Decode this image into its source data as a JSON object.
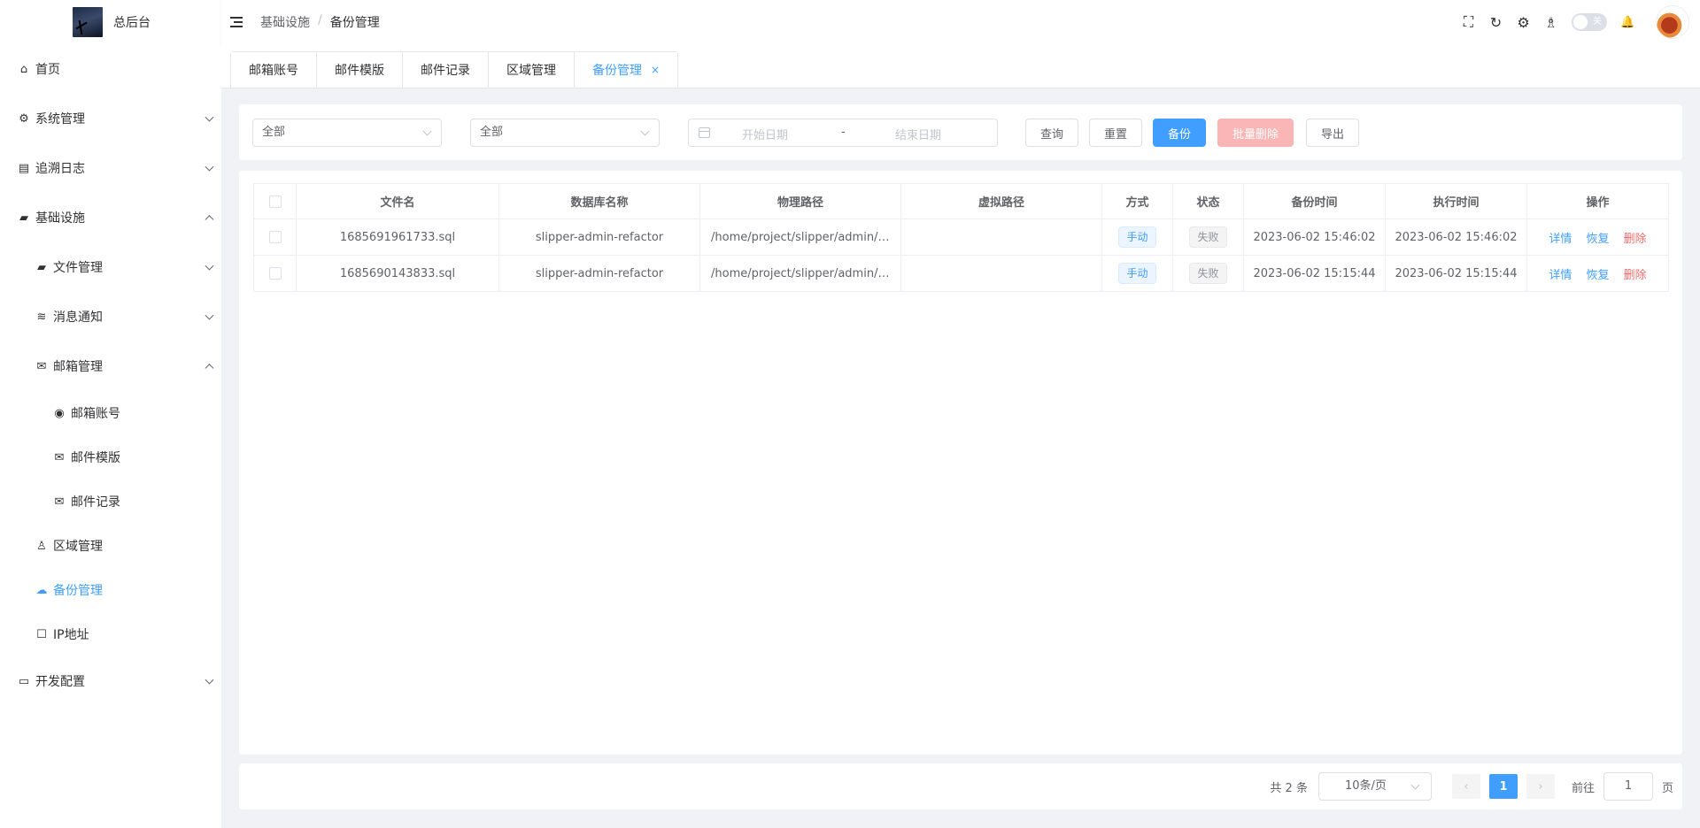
{
  "app": {
    "title": "总后台"
  },
  "sidebar": {
    "items": [
      {
        "label": "首页",
        "icon": "home-icon",
        "glyph": "⌂"
      },
      {
        "label": "系统管理",
        "icon": "gear-icon",
        "glyph": "⚙"
      },
      {
        "label": "追溯日志",
        "icon": "log-icon",
        "glyph": "▤"
      },
      {
        "label": "基础设施",
        "icon": "folder-icon",
        "glyph": "▰"
      },
      {
        "label": "文件管理",
        "icon": "folder-icon",
        "glyph": "▰"
      },
      {
        "label": "消息通知",
        "icon": "database-icon",
        "glyph": "≋"
      },
      {
        "label": "邮箱管理",
        "icon": "mail-icon",
        "glyph": "✉"
      },
      {
        "label": "邮箱账号",
        "icon": "account-icon",
        "glyph": "◉"
      },
      {
        "label": "邮件模版",
        "icon": "mail-icon",
        "glyph": "✉"
      },
      {
        "label": "邮件记录",
        "icon": "mail-icon",
        "glyph": "✉"
      },
      {
        "label": "区域管理",
        "icon": "user-icon",
        "glyph": "♙"
      },
      {
        "label": "备份管理",
        "icon": "cloud-upload-icon",
        "glyph": "☁"
      },
      {
        "label": "IP地址",
        "icon": "square-icon",
        "glyph": "☐"
      },
      {
        "label": "开发配置",
        "icon": "monitor-icon",
        "glyph": "▭"
      }
    ]
  },
  "header": {
    "breadcrumb": [
      "基础设施",
      "备份管理"
    ],
    "separator": "/",
    "switch_text": "关",
    "tools": {
      "fullscreen": "⛶",
      "refresh": "↻",
      "settings": "⚙",
      "broom": "♗",
      "bell": "🔔"
    }
  },
  "tabs": [
    {
      "label": "邮箱账号"
    },
    {
      "label": "邮件模版"
    },
    {
      "label": "邮件记录"
    },
    {
      "label": "区域管理"
    },
    {
      "label": "备份管理",
      "active": true,
      "close": "×"
    }
  ],
  "filters": {
    "select1": "全部",
    "select2": "全部",
    "date_start_placeholder": "开始日期",
    "date_separator": "-",
    "date_end_placeholder": "结束日期",
    "buttons": {
      "query": "查询",
      "reset": "重置",
      "backup": "备份",
      "batch_delete": "批量删除",
      "export": "导出"
    }
  },
  "table": {
    "columns": [
      "文件名",
      "数据库名称",
      "物理路径",
      "虚拟路径",
      "方式",
      "状态",
      "备份时间",
      "执行时间",
      "操作"
    ],
    "rows": [
      {
        "file": "1685691961733.sql",
        "db": "slipper-admin-refactor",
        "path": "/home/project/slipper/admin/r…",
        "vpath": "",
        "mode": "手动",
        "status": "失败",
        "backup_time": "2023-06-02 15:46:02",
        "exec_time": "2023-06-02 15:46:02"
      },
      {
        "file": "1685690143833.sql",
        "db": "slipper-admin-refactor",
        "path": "/home/project/slipper/admin/r…",
        "vpath": "",
        "mode": "手动",
        "status": "失败",
        "backup_time": "2023-06-02 15:15:44",
        "exec_time": "2023-06-02 15:15:44"
      }
    ],
    "actions": {
      "detail": "详情",
      "restore": "恢复",
      "delete": "删除"
    }
  },
  "pagination": {
    "total": "共 2 条",
    "page_size": "10条/页",
    "prev": "‹",
    "current": "1",
    "next": "›",
    "goto": "前往",
    "jump_value": "1",
    "page_unit": "页"
  },
  "colors": {
    "primary": "#409eff",
    "danger": "#f56c6c",
    "danger_disabled": "#fab6b6"
  }
}
